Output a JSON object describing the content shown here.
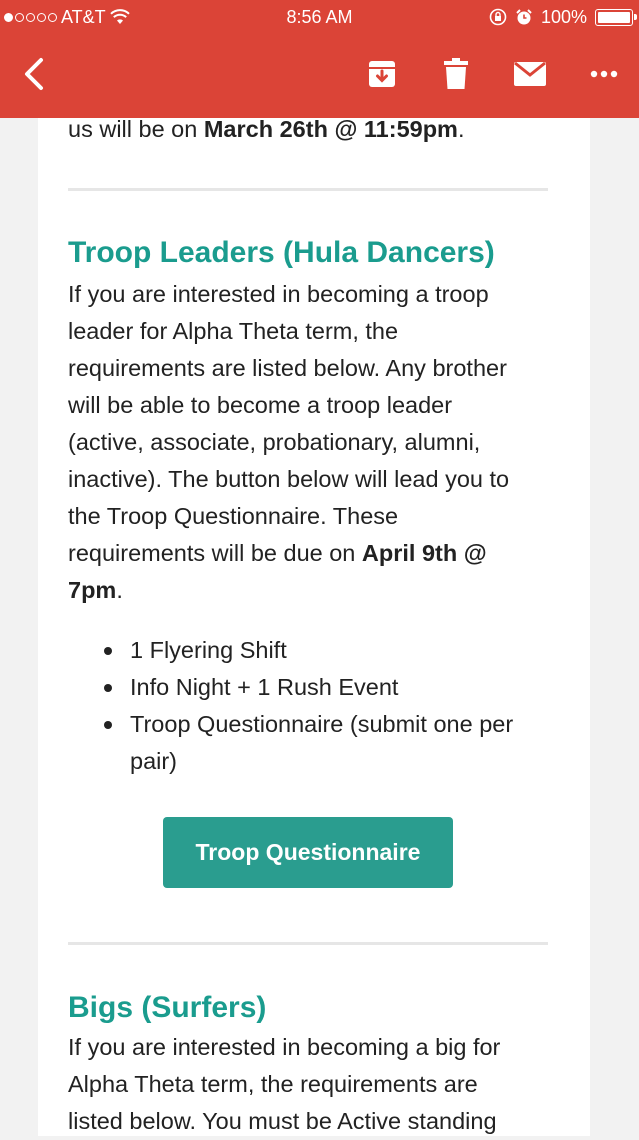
{
  "status_bar": {
    "carrier": "AT&T",
    "time": "8:56 AM",
    "battery": "100%"
  },
  "nav": {
    "icons": [
      "back-arrow-icon",
      "archive-icon",
      "trash-icon",
      "mail-icon",
      "more-icon"
    ]
  },
  "email": {
    "intro_prefix": "us will be on ",
    "intro_date": "March 26th @ 11:59pm",
    "intro_suffix": ".",
    "section1": {
      "heading": "Troop Leaders (Hula Dancers)",
      "body_lines": [
        "If you are interested in becoming a troop",
        "leader for Alpha Theta term, the",
        "requirements are listed below. Any brother",
        "will be able to become a troop leader",
        "(active, associate, probationary, alumni,",
        "inactive). The button below will lead you to",
        "the Troop Questionnaire. These"
      ],
      "due_prefix": "requirements will be due on ",
      "due_bold_1": "April 9th @",
      "due_bold_2": "7pm",
      "due_suffix": ".",
      "bullets": [
        "1 Flyering Shift",
        "Info Night + 1 Rush Event",
        "Troop Questionnaire (submit one per",
        "pair)"
      ],
      "button_label": "Troop Questionnaire"
    },
    "section2": {
      "heading": "Bigs (Surfers)",
      "body_lines": [
        "If you are interested in becoming a big for",
        "Alpha Theta term, the requirements are",
        "listed below. You must be Active standing"
      ]
    }
  },
  "colors": {
    "header": "#db4437",
    "heading": "#1a9c8e",
    "button": "#2a9d8f"
  }
}
